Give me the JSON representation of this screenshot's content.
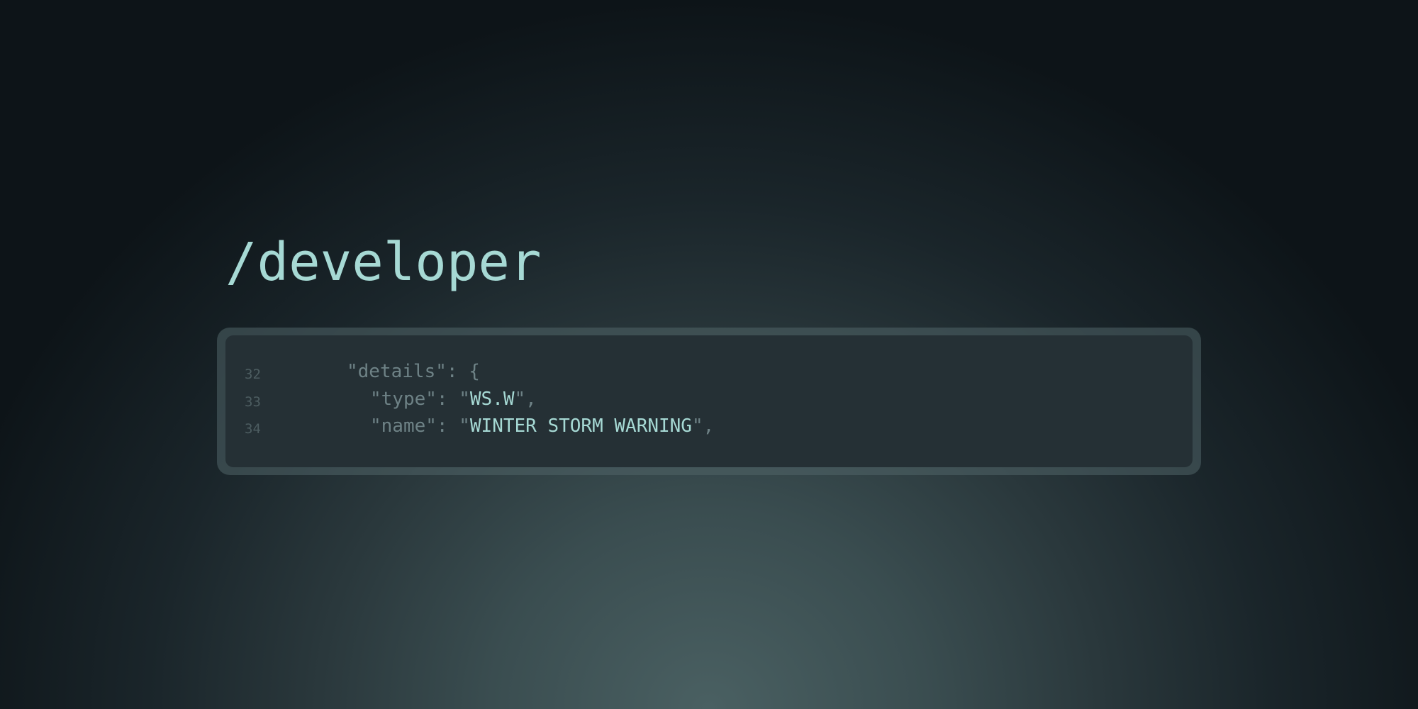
{
  "page": {
    "title": "/developer"
  },
  "code_block": {
    "lines": [
      {
        "number": "32",
        "key_open": "\"details\"",
        "separator": ": ",
        "brace": "{"
      },
      {
        "number": "33",
        "key": "\"type\"",
        "separator": ": \"",
        "value": "WS.W",
        "suffix": "\","
      },
      {
        "number": "34",
        "key": "\"name\"",
        "separator": ": \"",
        "value": "WINTER STORM WARNING",
        "suffix": "\","
      }
    ]
  },
  "colors": {
    "accent": "#a6d9d4",
    "muted_text": "#6e8286",
    "line_number": "#4d5d61",
    "panel_background": "#253035",
    "frame": "#4e6366"
  }
}
